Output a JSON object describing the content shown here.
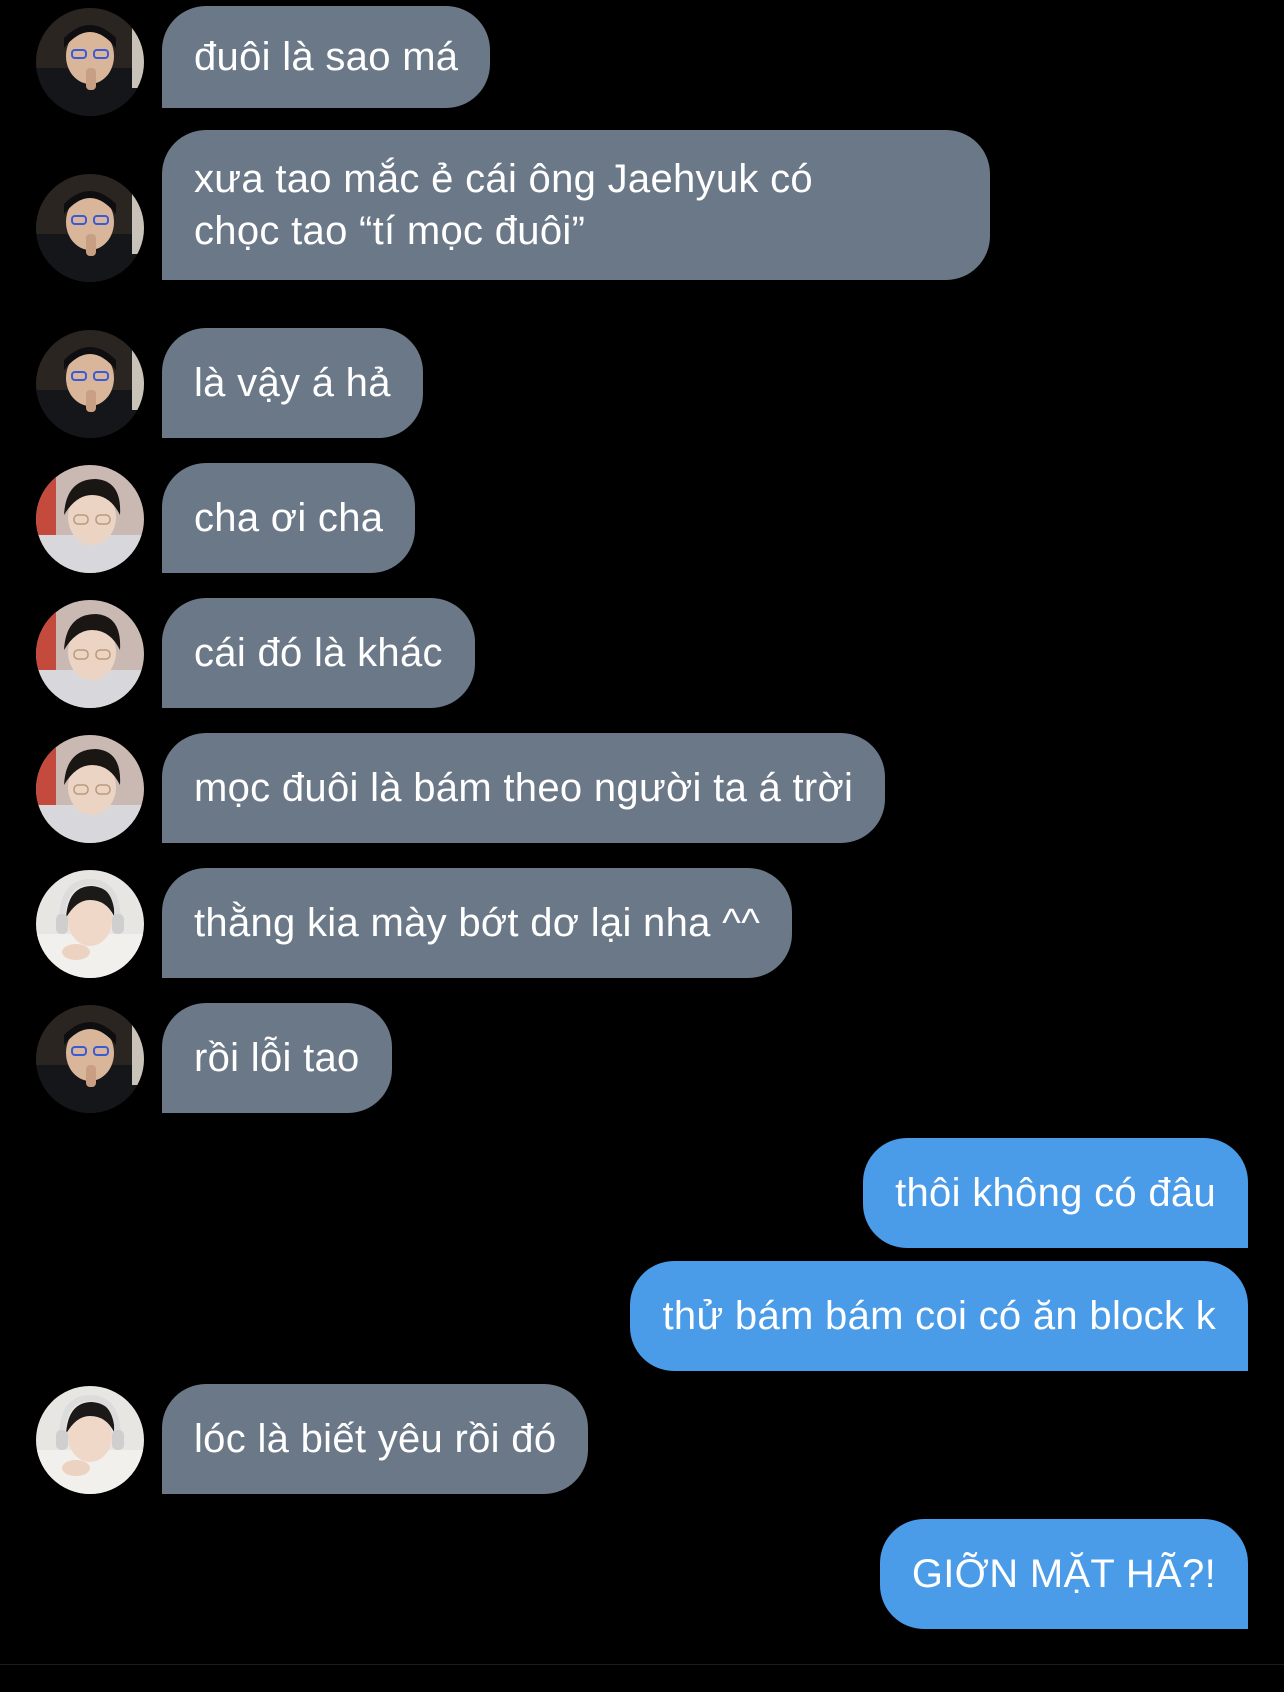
{
  "colors": {
    "background": "#000000",
    "incoming_bubble": "#6b7888",
    "outgoing_bubble": "#4a9be8",
    "text": "#ffffff"
  },
  "messages": [
    {
      "sender": "avatar-a",
      "direction": "incoming",
      "lines": [
        "đuôi là sao má"
      ]
    },
    {
      "sender": "avatar-a",
      "direction": "incoming",
      "lines": [
        "xưa tao mắc ẻ cái ông Jaehyuk có",
        "chọc tao “tí mọc đuôi”"
      ]
    },
    {
      "sender": "avatar-a",
      "direction": "incoming",
      "lines": [
        "là vậy á hả"
      ]
    },
    {
      "sender": "avatar-b",
      "direction": "incoming",
      "lines": [
        "cha ơi cha"
      ]
    },
    {
      "sender": "avatar-b",
      "direction": "incoming",
      "lines": [
        "cái đó là khác"
      ]
    },
    {
      "sender": "avatar-b",
      "direction": "incoming",
      "lines": [
        "mọc đuôi là bám theo người ta á trời"
      ]
    },
    {
      "sender": "avatar-c",
      "direction": "incoming",
      "lines": [
        "thằng kia mày bớt dơ lại nha ^^"
      ]
    },
    {
      "sender": "avatar-a",
      "direction": "incoming",
      "lines": [
        "rồi lỗi tao"
      ]
    },
    {
      "sender": "me",
      "direction": "outgoing",
      "lines": [
        "thôi không có đâu"
      ]
    },
    {
      "sender": "me",
      "direction": "outgoing",
      "lines": [
        "thử bám bám coi có ăn block k"
      ]
    },
    {
      "sender": "avatar-c",
      "direction": "incoming",
      "lines": [
        "lóc là biết yêu rồi đó"
      ]
    },
    {
      "sender": "me",
      "direction": "outgoing",
      "lines": [
        "GIỠN MẶT HÃ?!"
      ]
    }
  ]
}
